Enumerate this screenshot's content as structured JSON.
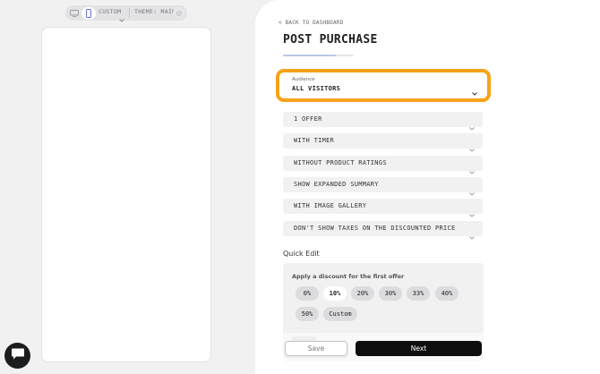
{
  "toolbar": {
    "device_label": "CUSTOM",
    "theme_label": "THEME: MAIN"
  },
  "header": {
    "back_label": "< BACK TO DASHBOARD",
    "title": "POST PURCHASE",
    "progress_fraction": 0.75
  },
  "audience": {
    "label": "Audience",
    "value": "ALL VISITORS"
  },
  "options": [
    {
      "label": "1 OFFER"
    },
    {
      "label": "WITH TIMER"
    },
    {
      "label": "WITHOUT PRODUCT RATINGS"
    },
    {
      "label": "SHOW EXPANDED SUMMARY"
    },
    {
      "label": "WITH IMAGE GALLERY"
    },
    {
      "label": "DON'T SHOW TAXES ON THE DISCOUNTED PRICE"
    }
  ],
  "quick_edit": {
    "heading": "Quick Edit",
    "discount_label": "Apply a discount for the first offer",
    "chips": [
      "0%",
      "10%",
      "20%",
      "30%",
      "33%",
      "40%",
      "50%",
      "Custom"
    ],
    "selected": "10%"
  },
  "footer": {
    "save_label": "Save",
    "next_label": "Next"
  },
  "colors": {
    "highlight_ring": "#f7a31a",
    "primary_button": "#0e0e0e"
  }
}
